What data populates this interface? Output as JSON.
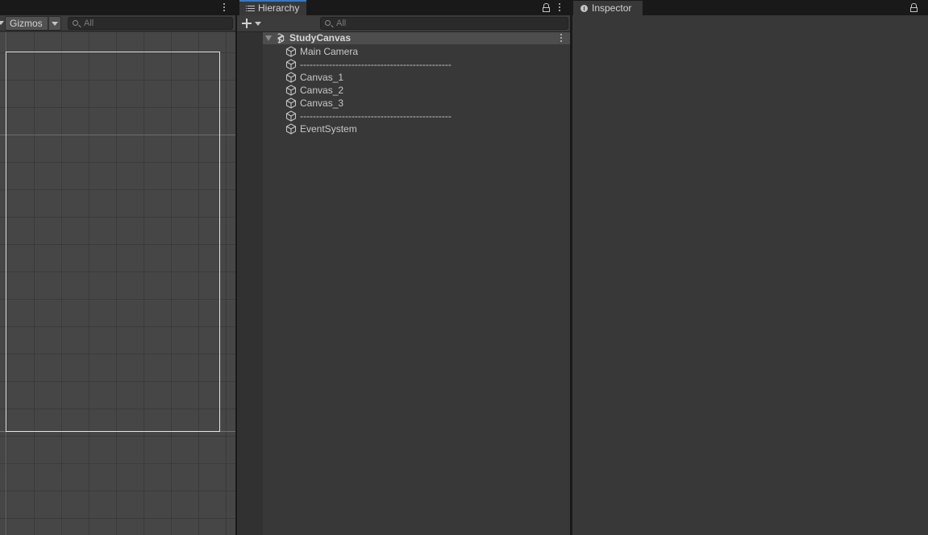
{
  "scene": {
    "gizmos_label": "Gizmos",
    "search_placeholder": "All"
  },
  "hierarchy": {
    "tab_label": "Hierarchy",
    "search_placeholder": "All",
    "scene_name": "StudyCanvas",
    "items": [
      {
        "label": "Main Camera"
      },
      {
        "label": "-----------------------------------------------"
      },
      {
        "label": "Canvas_1"
      },
      {
        "label": "Canvas_2"
      },
      {
        "label": "Canvas_3"
      },
      {
        "label": "-----------------------------------------------"
      },
      {
        "label": "EventSystem"
      }
    ]
  },
  "inspector": {
    "tab_label": "Inspector"
  },
  "colors": {
    "panel_bg": "#383838",
    "tab_bar_bg": "#191919",
    "active_tab_accent": "#3a79bb",
    "scene_row_bg": "#4d4d4d"
  },
  "icons": {
    "hierarchy_tab": "list-icon",
    "inspector_tab": "info-icon",
    "game_object": "cube-icon",
    "scene": "unity-logo-icon",
    "lock": "lock-icon",
    "menu": "kebab-icon",
    "search": "search-icon",
    "create": "plus-icon"
  }
}
